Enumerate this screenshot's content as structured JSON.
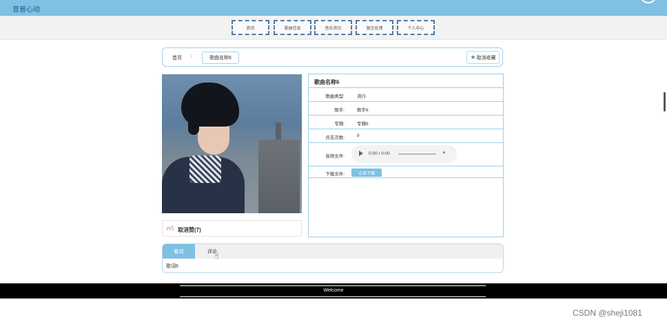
{
  "header": {
    "brand": "音普心动"
  },
  "nav": {
    "items": [
      "首页",
      "歌曲信息",
      "音乐资讯",
      "留言反馈",
      "个人中心"
    ]
  },
  "breadcrumb": {
    "home": "首页",
    "separator": "/",
    "current": "歌曲名称6"
  },
  "actions": {
    "favorite": "取消收藏"
  },
  "song": {
    "title": "歌曲名称6",
    "fields": [
      {
        "label": "歌曲类型:",
        "value": "流行"
      },
      {
        "label": "歌手:",
        "value": "歌手6"
      },
      {
        "label": "专辑:",
        "value": "专辑6"
      },
      {
        "label": "点击次数:",
        "value": "9"
      }
    ],
    "audio_label": "音频文件:",
    "audio_time": "0:00 / 0:00",
    "download_label": "下载文件:",
    "download_button": "点击下载",
    "like": "取消赞(7)"
  },
  "tabs": {
    "active": "歌词",
    "other": "评论",
    "content": "歌词6"
  },
  "footer": {
    "text": "Welcome"
  },
  "watermark": "CSDN @sheji1081",
  "colors": {
    "accent": "#7fc0e3",
    "border": "#9ecfe9",
    "like": "#d9534f"
  }
}
